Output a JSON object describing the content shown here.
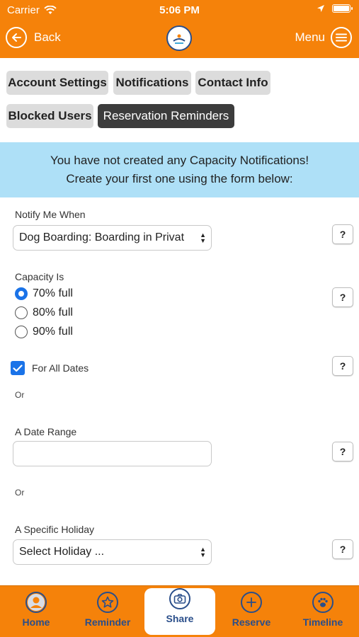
{
  "status_bar": {
    "carrier": "Carrier",
    "time": "5:06 PM"
  },
  "nav": {
    "back_label": "Back",
    "menu_label": "Menu"
  },
  "tabs": [
    {
      "label": "Account Settings",
      "active": false
    },
    {
      "label": "Notifications",
      "active": false
    },
    {
      "label": "Contact Info",
      "active": false
    },
    {
      "label": "Blocked Users",
      "active": false
    },
    {
      "label": "Reservation Reminders",
      "active": true
    }
  ],
  "banner": {
    "line1": "You have not created any Capacity Notifications!",
    "line2": "Create your first one using the form below:"
  },
  "form": {
    "notify_label": "Notify Me When",
    "notify_value": "Dog Boarding: Boarding in Privat",
    "capacity_label": "Capacity Is",
    "capacity_options": [
      {
        "label": "70% full",
        "checked": true
      },
      {
        "label": "80% full",
        "checked": false
      },
      {
        "label": "90% full",
        "checked": false
      }
    ],
    "all_dates_label": "For All Dates",
    "all_dates_checked": true,
    "or_1": "Or",
    "date_range_label": "A Date Range",
    "date_range_value": "",
    "or_2": "Or",
    "holiday_label": "A Specific Holiday",
    "holiday_value": "Select Holiday ...",
    "help_label": "?"
  },
  "bottom_nav": [
    {
      "label": "Home",
      "icon": "person-icon",
      "active": false
    },
    {
      "label": "Reminder",
      "icon": "star-icon",
      "active": false
    },
    {
      "label": "Share",
      "icon": "camera-icon",
      "active": true
    },
    {
      "label": "Reserve",
      "icon": "plus-icon",
      "active": false
    },
    {
      "label": "Timeline",
      "icon": "paw-icon",
      "active": false
    }
  ],
  "colors": {
    "brand_orange": "#f5820a",
    "banner_blue": "#aee0f7",
    "accent_blue": "#1a73e8",
    "nav_blue": "#2a4e8a",
    "active_tab": "#3c3c3c"
  }
}
